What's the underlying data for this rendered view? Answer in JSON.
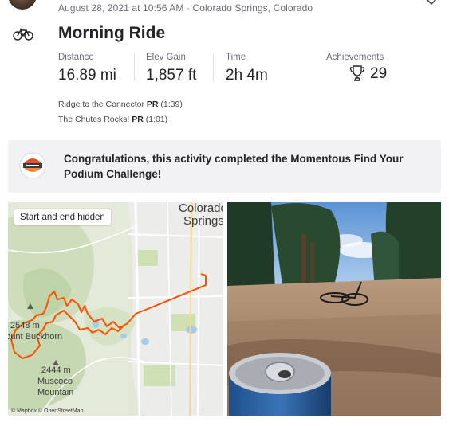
{
  "header": {
    "meta": "August 28, 2021 at 10:56 AM · Colorado Springs, Colorado",
    "title": "Morning Ride"
  },
  "stats": [
    {
      "label": "Distance",
      "value": "16.89 mi"
    },
    {
      "label": "Elev Gain",
      "value": "1,857 ft"
    },
    {
      "label": "Time",
      "value": "2h 4m"
    }
  ],
  "achievements": {
    "label": "Achievements",
    "value": "29"
  },
  "segments": [
    {
      "name": "Ridge to the Connector",
      "badge": "PR",
      "time": "(1:39)"
    },
    {
      "name": "The Chutes Rocks!",
      "badge": "PR",
      "time": "(1:01)"
    }
  ],
  "challenge": {
    "text": "Congratulations, this activity completed the Momentous Find Your Podium Challenge!"
  },
  "map": {
    "badge": "Start and end hidden",
    "labels": {
      "city_line1": "Colorado",
      "city_line2": "Springs",
      "peak1_elev": "2548 m",
      "peak1_name": "Mount Buckhorn",
      "peak2_elev": "2444 m",
      "peak2_name_line1": "Muscoco",
      "peak2_name_line2": "Mountain",
      "attribution": "© Mapbox © OpenStreetMap"
    },
    "route_color": "#fc5200"
  },
  "colors": {
    "text": "#242428",
    "muted": "#6d6d78",
    "banner_bg": "#f2f2f5",
    "accent": "#fc5200"
  },
  "icons": {
    "activity": "bike-icon",
    "achievements": "trophy-icon",
    "menu": "chevron-down-icon"
  }
}
